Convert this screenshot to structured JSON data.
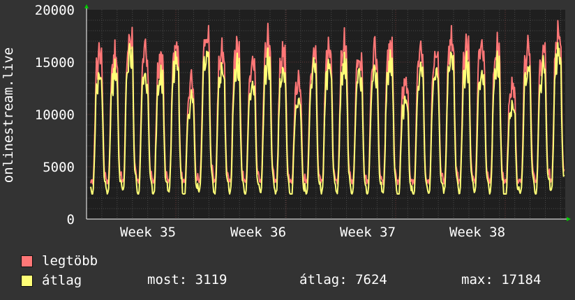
{
  "chart_data": {
    "type": "line",
    "ylabel": "onlinestream.live",
    "ylim": [
      0,
      20000
    ],
    "yticks": [
      0,
      5000,
      10000,
      15000,
      20000
    ],
    "xticks": [
      "Week 35",
      "Week 36",
      "Week 37",
      "Week 38"
    ],
    "grid": true,
    "series": [
      {
        "name": "legtöbb",
        "color": "#ff7777",
        "daily_peaks": [
          16500,
          16200,
          18000,
          16600,
          16000,
          17000,
          13500,
          18200,
          16700,
          17000,
          16100,
          17700,
          16500,
          13700,
          16400,
          16900,
          17300,
          16000,
          16800,
          17100,
          13600,
          16100,
          16400,
          17800,
          17200,
          17700,
          16900,
          13200,
          16900,
          16700,
          18500
        ]
      },
      {
        "name": "átlag",
        "color": "#ffff77",
        "daily_peaks": [
          14200,
          14600,
          16500,
          14200,
          14000,
          15800,
          11800,
          16300,
          14800,
          15100,
          14000,
          15600,
          14600,
          11700,
          14700,
          15300,
          15200,
          14400,
          14700,
          15400,
          11800,
          14300,
          14600,
          16100,
          15300,
          15100,
          15300,
          11200,
          14800,
          14900,
          16600
        ]
      }
    ]
  },
  "legend": {
    "max_label": "legtöbb",
    "avg_label": "átlag",
    "now_text": "most: 3119",
    "avg_text": "átlag: 7624",
    "max_text": "max: 17184"
  }
}
